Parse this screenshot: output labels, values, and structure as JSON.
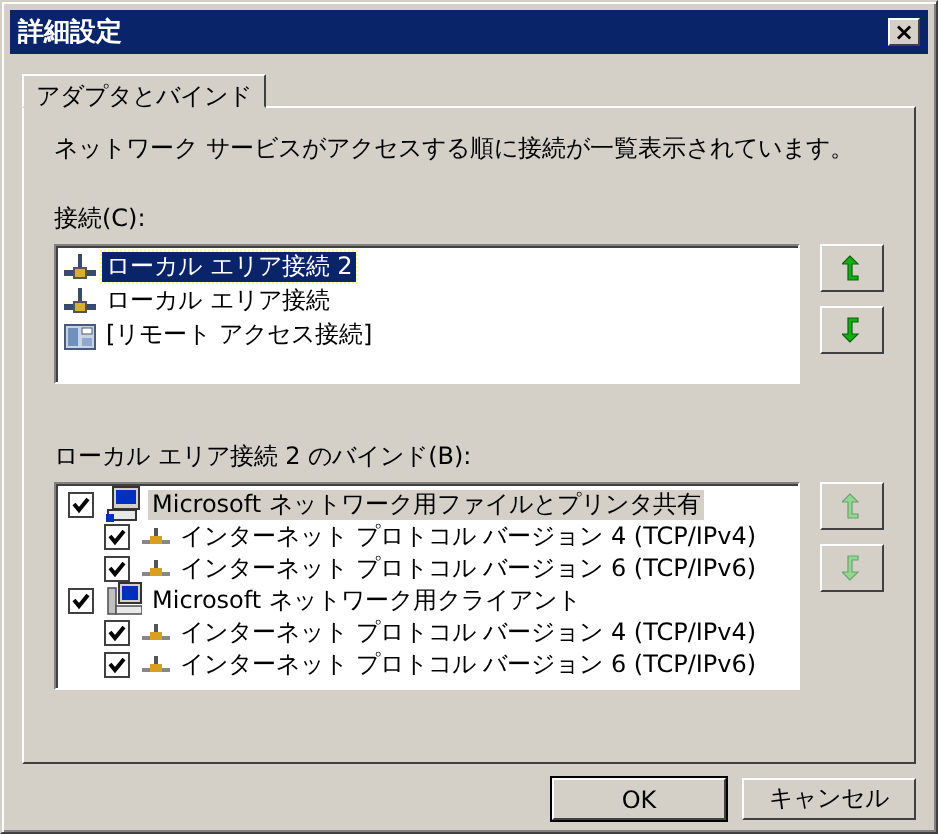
{
  "window": {
    "title": "詳細設定",
    "close": "×"
  },
  "tabs": [
    {
      "label": "アダプタとバインド",
      "selected": true
    }
  ],
  "description": "ネットワーク サービスがアクセスする順に接続が一覧表示されています。",
  "connections": {
    "label": "接続(C):",
    "items": [
      {
        "label": "ローカル エリア接続 2",
        "kind": "lan",
        "selected": true
      },
      {
        "label": "ローカル エリア接続",
        "kind": "lan",
        "selected": false
      },
      {
        "label": "[リモート アクセス接続]",
        "kind": "dialup",
        "selected": false
      }
    ],
    "move_up": {
      "disabled": false
    },
    "move_down": {
      "disabled": false
    }
  },
  "bindings": {
    "label": "ローカル エリア接続 2 のバインド(B):",
    "items": [
      {
        "label": "Microsoft ネットワーク用ファイルとプリンタ共有",
        "kind": "service",
        "checked": true,
        "selected": true,
        "children": [
          {
            "label": "インターネット プロトコル バージョン 4 (TCP/IPv4)",
            "kind": "protocol",
            "checked": true,
            "selected": false
          },
          {
            "label": "インターネット プロトコル バージョン 6 (TCP/IPv6)",
            "kind": "protocol",
            "checked": true,
            "selected": false
          }
        ]
      },
      {
        "label": "Microsoft ネットワーク用クライアント",
        "kind": "client",
        "checked": true,
        "selected": false,
        "children": [
          {
            "label": "インターネット プロトコル バージョン 4 (TCP/IPv4)",
            "kind": "protocol",
            "checked": true,
            "selected": false
          },
          {
            "label": "インターネット プロトコル バージョン 6 (TCP/IPv6)",
            "kind": "protocol",
            "checked": true,
            "selected": false
          }
        ]
      }
    ],
    "move_up": {
      "disabled": true
    },
    "move_down": {
      "disabled": true
    }
  },
  "buttons": [
    {
      "label": "OK",
      "default": true
    },
    {
      "label": "キャンセル",
      "default": false
    }
  ]
}
